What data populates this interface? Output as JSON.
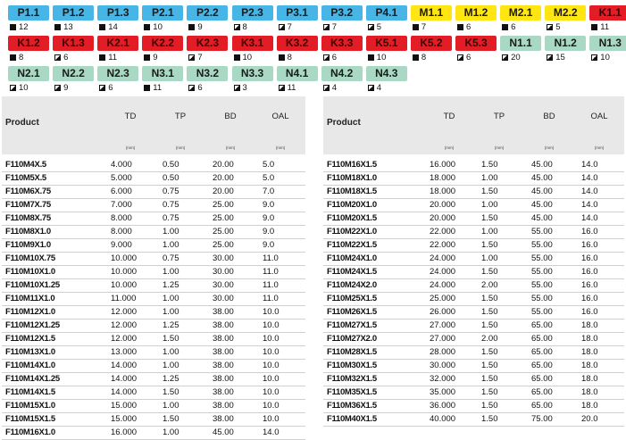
{
  "colors": {
    "blue": "#47b5e5",
    "yellow": "#ffe512",
    "red": "#e21d25",
    "green": "#a9d9c4",
    "header_bg": "#e8e8e8"
  },
  "badges": [
    {
      "label": "P1.1",
      "color": "blue",
      "icon": "solid-square-icon",
      "value": "12"
    },
    {
      "label": "P1.2",
      "color": "blue",
      "icon": "solid-square-icon",
      "value": "13"
    },
    {
      "label": "P1.3",
      "color": "blue",
      "icon": "solid-square-icon",
      "value": "14"
    },
    {
      "label": "P2.1",
      "color": "blue",
      "icon": "solid-square-icon",
      "value": "10"
    },
    {
      "label": "P2.2",
      "color": "blue",
      "icon": "solid-square-icon",
      "value": "9"
    },
    {
      "label": "P2.3",
      "color": "blue",
      "icon": "half-square-icon",
      "value": "8"
    },
    {
      "label": "P3.1",
      "color": "blue",
      "icon": "half-square-icon",
      "value": "7"
    },
    {
      "label": "P3.2",
      "color": "blue",
      "icon": "half-square-icon",
      "value": "7"
    },
    {
      "label": "P4.1",
      "color": "blue",
      "icon": "half-square-icon",
      "value": "5"
    },
    {
      "label": "M1.1",
      "color": "yellow",
      "icon": "solid-square-icon",
      "value": "7"
    },
    {
      "label": "M1.2",
      "color": "yellow",
      "icon": "solid-square-icon",
      "value": "6"
    },
    {
      "label": "M2.1",
      "color": "yellow",
      "icon": "solid-square-icon",
      "value": "6"
    },
    {
      "label": "M2.2",
      "color": "yellow",
      "icon": "half-square-icon",
      "value": "5"
    },
    {
      "label": "K1.1",
      "color": "red",
      "icon": "solid-square-icon",
      "value": "11"
    },
    {
      "label": "K1.2",
      "color": "red",
      "icon": "solid-square-icon",
      "value": "8"
    },
    {
      "label": "K1.3",
      "color": "red",
      "icon": "half-square-icon",
      "value": "6"
    },
    {
      "label": "K2.1",
      "color": "red",
      "icon": "solid-square-icon",
      "value": "11"
    },
    {
      "label": "K2.2",
      "color": "red",
      "icon": "solid-square-icon",
      "value": "9"
    },
    {
      "label": "K2.3",
      "color": "red",
      "icon": "half-square-icon",
      "value": "7"
    },
    {
      "label": "K3.1",
      "color": "red",
      "icon": "solid-square-icon",
      "value": "10"
    },
    {
      "label": "K3.2",
      "color": "red",
      "icon": "solid-square-icon",
      "value": "8"
    },
    {
      "label": "K3.3",
      "color": "red",
      "icon": "half-square-icon",
      "value": "6"
    },
    {
      "label": "K5.1",
      "color": "red",
      "icon": "solid-square-icon",
      "value": "10"
    },
    {
      "label": "K5.2",
      "color": "red",
      "icon": "solid-square-icon",
      "value": "8"
    },
    {
      "label": "K5.3",
      "color": "red",
      "icon": "half-square-icon",
      "value": "6"
    },
    {
      "label": "N1.1",
      "color": "green",
      "icon": "half-square-icon",
      "value": "20"
    },
    {
      "label": "N1.2",
      "color": "green",
      "icon": "half-square-icon",
      "value": "15"
    },
    {
      "label": "N1.3",
      "color": "green",
      "icon": "half-square-icon",
      "value": "10"
    },
    {
      "label": "N2.1",
      "color": "green",
      "icon": "half-square-icon",
      "value": "10"
    },
    {
      "label": "N2.2",
      "color": "green",
      "icon": "half-square-icon",
      "value": "9"
    },
    {
      "label": "N2.3",
      "color": "green",
      "icon": "half-square-icon",
      "value": "6"
    },
    {
      "label": "N3.1",
      "color": "green",
      "icon": "solid-square-icon",
      "value": "11"
    },
    {
      "label": "N3.2",
      "color": "green",
      "icon": "half-square-icon",
      "value": "6"
    },
    {
      "label": "N3.3",
      "color": "green",
      "icon": "half-square-icon",
      "value": "3"
    },
    {
      "label": "N4.1",
      "color": "green",
      "icon": "half-square-icon",
      "value": "11"
    },
    {
      "label": "N4.2",
      "color": "green",
      "icon": "half-square-icon",
      "value": "4"
    },
    {
      "label": "N4.3",
      "color": "green",
      "icon": "half-square-icon",
      "value": "4"
    }
  ],
  "table": {
    "columns": {
      "product": "Product",
      "td": "TD",
      "tp": "TP",
      "bd": "BD",
      "oal": "OAL"
    },
    "unit": "(mm)",
    "left_rows": [
      [
        "F110M4X.5",
        "4.000",
        "0.50",
        "20.00",
        "5.0"
      ],
      [
        "F110M5X.5",
        "5.000",
        "0.50",
        "20.00",
        "5.0"
      ],
      [
        "F110M6X.75",
        "6.000",
        "0.75",
        "20.00",
        "7.0"
      ],
      [
        "F110M7X.75",
        "7.000",
        "0.75",
        "25.00",
        "9.0"
      ],
      [
        "F110M8X.75",
        "8.000",
        "0.75",
        "25.00",
        "9.0"
      ],
      [
        "F110M8X1.0",
        "8.000",
        "1.00",
        "25.00",
        "9.0"
      ],
      [
        "F110M9X1.0",
        "9.000",
        "1.00",
        "25.00",
        "9.0"
      ],
      [
        "F110M10X.75",
        "10.000",
        "0.75",
        "30.00",
        "11.0"
      ],
      [
        "F110M10X1.0",
        "10.000",
        "1.00",
        "30.00",
        "11.0"
      ],
      [
        "F110M10X1.25",
        "10.000",
        "1.25",
        "30.00",
        "11.0"
      ],
      [
        "F110M11X1.0",
        "11.000",
        "1.00",
        "30.00",
        "11.0"
      ],
      [
        "F110M12X1.0",
        "12.000",
        "1.00",
        "38.00",
        "10.0"
      ],
      [
        "F110M12X1.25",
        "12.000",
        "1.25",
        "38.00",
        "10.0"
      ],
      [
        "F110M12X1.5",
        "12.000",
        "1.50",
        "38.00",
        "10.0"
      ],
      [
        "F110M13X1.0",
        "13.000",
        "1.00",
        "38.00",
        "10.0"
      ],
      [
        "F110M14X1.0",
        "14.000",
        "1.00",
        "38.00",
        "10.0"
      ],
      [
        "F110M14X1.25",
        "14.000",
        "1.25",
        "38.00",
        "10.0"
      ],
      [
        "F110M14X1.5",
        "14.000",
        "1.50",
        "38.00",
        "10.0"
      ],
      [
        "F110M15X1.0",
        "15.000",
        "1.00",
        "38.00",
        "10.0"
      ],
      [
        "F110M15X1.5",
        "15.000",
        "1.50",
        "38.00",
        "10.0"
      ],
      [
        "F110M16X1.0",
        "16.000",
        "1.00",
        "45.00",
        "14.0"
      ]
    ],
    "right_rows": [
      [
        "F110M16X1.5",
        "16.000",
        "1.50",
        "45.00",
        "14.0"
      ],
      [
        "F110M18X1.0",
        "18.000",
        "1.00",
        "45.00",
        "14.0"
      ],
      [
        "F110M18X1.5",
        "18.000",
        "1.50",
        "45.00",
        "14.0"
      ],
      [
        "F110M20X1.0",
        "20.000",
        "1.00",
        "45.00",
        "14.0"
      ],
      [
        "F110M20X1.5",
        "20.000",
        "1.50",
        "45.00",
        "14.0"
      ],
      [
        "F110M22X1.0",
        "22.000",
        "1.00",
        "55.00",
        "16.0"
      ],
      [
        "F110M22X1.5",
        "22.000",
        "1.50",
        "55.00",
        "16.0"
      ],
      [
        "F110M24X1.0",
        "24.000",
        "1.00",
        "55.00",
        "16.0"
      ],
      [
        "F110M24X1.5",
        "24.000",
        "1.50",
        "55.00",
        "16.0"
      ],
      [
        "F110M24X2.0",
        "24.000",
        "2.00",
        "55.00",
        "16.0"
      ],
      [
        "F110M25X1.5",
        "25.000",
        "1.50",
        "55.00",
        "16.0"
      ],
      [
        "F110M26X1.5",
        "26.000",
        "1.50",
        "55.00",
        "16.0"
      ],
      [
        "F110M27X1.5",
        "27.000",
        "1.50",
        "65.00",
        "18.0"
      ],
      [
        "F110M27X2.0",
        "27.000",
        "2.00",
        "65.00",
        "18.0"
      ],
      [
        "F110M28X1.5",
        "28.000",
        "1.50",
        "65.00",
        "18.0"
      ],
      [
        "F110M30X1.5",
        "30.000",
        "1.50",
        "65.00",
        "18.0"
      ],
      [
        "F110M32X1.5",
        "32.000",
        "1.50",
        "65.00",
        "18.0"
      ],
      [
        "F110M35X1.5",
        "35.000",
        "1.50",
        "65.00",
        "18.0"
      ],
      [
        "F110M36X1.5",
        "36.000",
        "1.50",
        "65.00",
        "18.0"
      ],
      [
        "F110M40X1.5",
        "40.000",
        "1.50",
        "75.00",
        "20.0"
      ]
    ]
  }
}
